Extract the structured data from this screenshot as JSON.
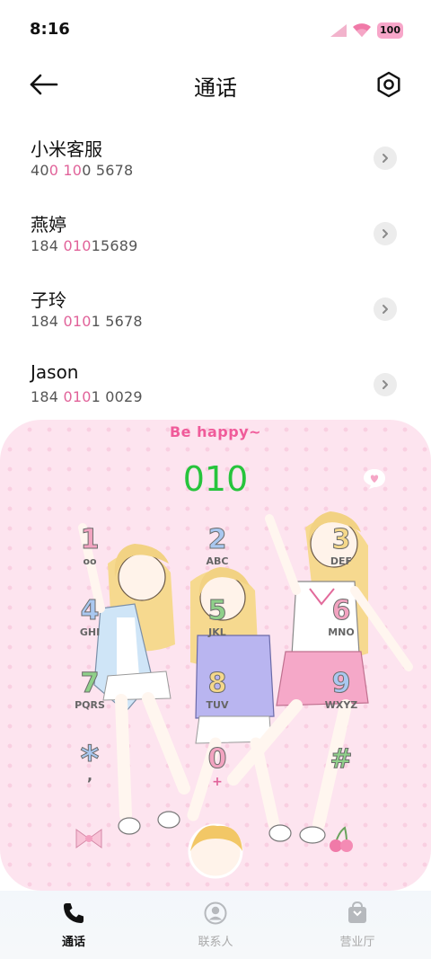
{
  "status_bar": {
    "time": "8:16",
    "battery": "100"
  },
  "header": {
    "title": "通话"
  },
  "contacts": [
    {
      "name": "小米客服",
      "num_parts": [
        "40",
        "0 10",
        "0 5678"
      ]
    },
    {
      "name": "燕婷",
      "num_parts": [
        "184 ",
        "010",
        "15689"
      ]
    },
    {
      "name": "子玲",
      "num_parts": [
        "184 ",
        "010",
        "1 5678"
      ]
    },
    {
      "name": "Jason",
      "num_parts": [
        "184 ",
        "010",
        "1 0029"
      ]
    }
  ],
  "dialer": {
    "slogan": "Be happy~",
    "input": "010",
    "keys": [
      {
        "digit": "1",
        "letters": "oo",
        "color": "#f2a3c0"
      },
      {
        "digit": "2",
        "letters": "ABC",
        "color": "#a9c8f0"
      },
      {
        "digit": "3",
        "letters": "DEF",
        "color": "#f5d88a"
      },
      {
        "digit": "4",
        "letters": "GHI",
        "color": "#a9c8f0"
      },
      {
        "digit": "5",
        "letters": "JKL",
        "color": "#8fd08a"
      },
      {
        "digit": "6",
        "letters": "MNO",
        "color": "#f2a3c0"
      },
      {
        "digit": "7",
        "letters": "PQRS",
        "color": "#8fd08a"
      },
      {
        "digit": "8",
        "letters": "TUV",
        "color": "#f5d88a"
      },
      {
        "digit": "9",
        "letters": "WXYZ",
        "color": "#a9c8f0"
      },
      {
        "digit": "0",
        "letters": "+",
        "color": "#f2a3c0"
      }
    ],
    "star": {
      "symbol": "*",
      "sub": ",",
      "color": "#a9c8f0"
    },
    "hash": {
      "symbol": "#",
      "color": "#8fd08a"
    }
  },
  "bottom_nav": [
    {
      "label": "通话",
      "icon": "phone-icon",
      "active": true
    },
    {
      "label": "联系人",
      "icon": "person-icon",
      "active": false
    },
    {
      "label": "营业厅",
      "icon": "bag-icon",
      "active": false
    }
  ],
  "colors": {
    "accent_pink": "#e1639a",
    "dialed_green": "#27c43c",
    "dialer_bg": "#fde4ef"
  }
}
